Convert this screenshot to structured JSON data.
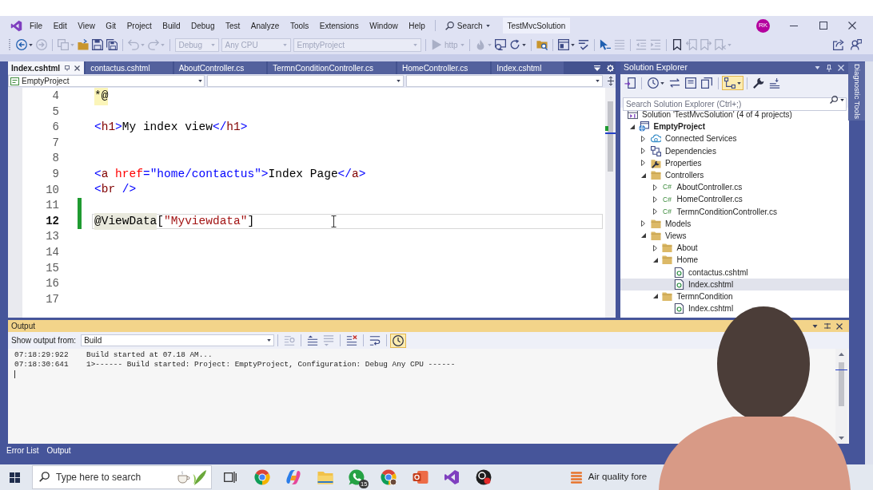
{
  "title_bar": {
    "menu": [
      "File",
      "Edit",
      "View",
      "Git",
      "Project",
      "Build",
      "Debug",
      "Test",
      "Analyze",
      "Tools",
      "Extensions",
      "Window",
      "Help"
    ],
    "search": "Search",
    "solution": "TestMvcSolution",
    "account_initials": "RK"
  },
  "toolbar": {
    "groups": [
      [
        {
          "kind": "back",
          "disabled": false,
          "menu": true
        },
        {
          "kind": "forward",
          "disabled": true
        }
      ],
      [
        {
          "kind": "new_item",
          "disabled": true,
          "menu": true
        },
        {
          "kind": "open",
          "disabled": false
        },
        {
          "kind": "save",
          "disabled": false
        },
        {
          "kind": "save_all",
          "disabled": false
        }
      ],
      [
        {
          "kind": "undo",
          "disabled": true,
          "menu": true
        },
        {
          "kind": "redo",
          "disabled": true,
          "menu": true
        }
      ],
      [
        {
          "kind": "combo",
          "value": "Debug",
          "disabled": true
        },
        {
          "kind": "combo",
          "value": "Any CPU",
          "disabled": true
        },
        {
          "kind": "combo",
          "value": "EmptyProject",
          "disabled": true
        }
      ],
      [
        {
          "kind": "start",
          "label": "http",
          "disabled": true,
          "menu": true
        }
      ],
      [
        {
          "kind": "hot_reload",
          "disabled": true,
          "menu": true
        },
        {
          "kind": "browser_link",
          "disabled": false
        },
        {
          "kind": "refresh",
          "disabled": false,
          "menu": true
        }
      ],
      [
        {
          "kind": "find_files",
          "disabled": false
        }
      ],
      [
        {
          "kind": "layout",
          "disabled": false,
          "menu": true
        },
        {
          "kind": "spellcheck",
          "disabled": false
        }
      ],
      [
        {
          "kind": "pointer",
          "disabled": false
        },
        {
          "kind": "comment",
          "disabled": true
        }
      ],
      [
        {
          "kind": "outdent",
          "disabled": true
        },
        {
          "kind": "indent",
          "disabled": true
        }
      ],
      [
        {
          "kind": "bookmark",
          "disabled": false
        },
        {
          "kind": "prev_bookmark",
          "disabled": true
        },
        {
          "kind": "next_bookmark",
          "disabled": true
        },
        {
          "kind": "clear_bookmarks",
          "disabled": true,
          "menu": true
        }
      ]
    ],
    "end": [
      {
        "kind": "share",
        "disabled": false
      },
      {
        "kind": "feedback",
        "disabled": false
      }
    ]
  },
  "editor_tabs": [
    {
      "label": "Index.cshtml",
      "selected": true
    },
    {
      "label": "contactus.cshtml",
      "selected": false
    },
    {
      "label": "AboutController.cs",
      "selected": false
    },
    {
      "label": "TermnConditionController.cs",
      "selected": false
    },
    {
      "label": "HomeController.cs",
      "selected": false
    },
    {
      "label": "Index.cshtml",
      "selected": false
    }
  ],
  "navigation_bar": {
    "project": "EmptyProject"
  },
  "code_lines": [
    {
      "number": "4",
      "current": false,
      "changed": false,
      "tokens": [
        {
          "kind": "razor_delimiter",
          "text": "*@"
        }
      ]
    },
    {
      "number": "5",
      "current": false,
      "changed": false
    },
    {
      "number": "6",
      "current": false,
      "changed": false,
      "tokens": [
        {
          "kind": "delimiter",
          "text": "<"
        },
        {
          "kind": "element",
          "text": "h1"
        },
        {
          "kind": "delimiter",
          "text": ">"
        },
        {
          "kind": "text",
          "text": "My index view"
        },
        {
          "kind": "delimiter",
          "text": "</"
        },
        {
          "kind": "element",
          "text": "h1"
        },
        {
          "kind": "delimiter",
          "text": ">"
        }
      ]
    },
    {
      "number": "7",
      "current": false,
      "changed": false
    },
    {
      "number": "8",
      "current": false,
      "changed": false
    },
    {
      "number": "9",
      "current": false,
      "changed": false,
      "tokens": [
        {
          "kind": "delimiter",
          "text": "<"
        },
        {
          "kind": "element",
          "text": "a"
        },
        {
          "kind": "attribute",
          "text": " href"
        },
        {
          "kind": "delimiter",
          "text": "="
        },
        {
          "kind": "value",
          "text": "\"home/contactus\""
        },
        {
          "kind": "delimiter",
          "text": ">"
        },
        {
          "kind": "text",
          "text": "Index Page"
        },
        {
          "kind": "delimiter",
          "text": "</"
        },
        {
          "kind": "element",
          "text": "a"
        },
        {
          "kind": "delimiter",
          "text": ">"
        }
      ]
    },
    {
      "number": "10",
      "current": false,
      "changed": false,
      "tokens": [
        {
          "kind": "delimiter",
          "text": "<"
        },
        {
          "kind": "element",
          "text": "br"
        },
        {
          "kind": "delimiter",
          "text": " />"
        }
      ]
    },
    {
      "number": "11",
      "current": false,
      "changed": true
    },
    {
      "number": "12",
      "current": true,
      "changed": true,
      "tokens": [
        {
          "kind": "razor",
          "text": "@ViewData"
        },
        {
          "kind": "text",
          "text": "["
        },
        {
          "kind": "string",
          "text": "\"Myviewdata\""
        },
        {
          "kind": "text",
          "text": "]"
        }
      ]
    },
    {
      "number": "13",
      "current": false,
      "changed": false
    },
    {
      "number": "14",
      "current": false,
      "changed": false
    },
    {
      "number": "15",
      "current": false,
      "changed": false
    },
    {
      "number": "16",
      "current": false,
      "changed": false
    },
    {
      "number": "17",
      "current": false,
      "changed": false
    }
  ],
  "solution_explorer": {
    "title": "Solution Explorer",
    "toolbar": [
      [
        {
          "kind": "sync",
          "on": false
        }
      ],
      [
        {
          "kind": "history",
          "on": false,
          "menu": true
        },
        {
          "kind": "swap",
          "on": false
        },
        {
          "kind": "collapse_all",
          "on": false
        },
        {
          "kind": "copy",
          "on": false
        }
      ],
      [
        {
          "kind": "tree_view",
          "on": true,
          "menu": true
        }
      ],
      [
        {
          "kind": "properties",
          "on": false
        },
        {
          "kind": "preview",
          "on": false
        }
      ]
    ],
    "search_placeholder": "Search Solution Explorer (Ctrl+;)",
    "tree": [
      {
        "label": "Solution 'TestMvcSolution' (4 of 4 projects)",
        "kind": "solution",
        "selected": false,
        "children": [
          {
            "label": "EmptyProject",
            "kind": "project",
            "expanded": true,
            "selected": false,
            "children": [
              {
                "label": "Connected Services",
                "kind": "connected_services",
                "expanded": false,
                "selected": false
              },
              {
                "label": "Dependencies",
                "kind": "dependencies",
                "expanded": false,
                "selected": false
              },
              {
                "label": "Properties",
                "kind": "properties",
                "expanded": false,
                "selected": false
              },
              {
                "label": "Controllers",
                "kind": "folder",
                "expanded": true,
                "selected": false,
                "children": [
                  {
                    "label": "AboutController.cs",
                    "kind": "csharp",
                    "badge": "C#",
                    "expanded": false,
                    "selected": false
                  },
                  {
                    "label": "HomeController.cs",
                    "kind": "csharp",
                    "badge": "C#",
                    "expanded": false,
                    "selected": false
                  },
                  {
                    "label": "TermnConditionController.cs",
                    "kind": "csharp",
                    "badge": "C#",
                    "expanded": false,
                    "selected": false
                  }
                ]
              },
              {
                "label": "Models",
                "kind": "folder",
                "expanded": false,
                "selected": false
              },
              {
                "label": "Views",
                "kind": "folder",
                "expanded": true,
                "selected": false,
                "children": [
                  {
                    "label": "About",
                    "kind": "folder",
                    "expanded": false,
                    "selected": false
                  },
                  {
                    "label": "Home",
                    "kind": "folder",
                    "expanded": true,
                    "selected": false,
                    "children": [
                      {
                        "label": "contactus.cshtml",
                        "kind": "razor",
                        "selected": false
                      },
                      {
                        "label": "Index.cshtml",
                        "kind": "razor",
                        "selected": true
                      }
                    ]
                  },
                  {
                    "label": "TermnCondition",
                    "kind": "folder",
                    "expanded": true,
                    "selected": false,
                    "children": [
                      {
                        "label": "Index.cshtml",
                        "kind": "razor",
                        "selected": false
                      }
                    ]
                  }
                ]
              }
            ]
          }
        ]
      }
    ]
  },
  "side_tab": "Diagnostic Tools",
  "output": {
    "title": "Output",
    "source_label": "Show output from:",
    "source": "Build",
    "toolbar": [
      [
        {
          "kind": "find_message",
          "disabled": true,
          "on": false
        }
      ],
      [
        {
          "kind": "prev_message",
          "disabled": false,
          "on": false
        },
        {
          "kind": "next_message",
          "disabled": true,
          "on": false
        }
      ],
      [
        {
          "kind": "clear",
          "disabled": false,
          "on": false
        }
      ],
      [
        {
          "kind": "word_wrap",
          "disabled": false,
          "on": false
        }
      ],
      [
        {
          "kind": "timestamps",
          "disabled": false,
          "on": true
        }
      ]
    ],
    "lines": [
      {
        "time": "07:18:29:922",
        "message": "Build started at 07.18 AM..."
      },
      {
        "time": "07:18:30:641",
        "message": "1>------ Build started: Project: EmptyProject, Configuration: Debug Any CPU ------"
      }
    ]
  },
  "bottom_tabs": [
    "Error List",
    "Output"
  ],
  "taskbar": {
    "search_placeholder": "Type here to search",
    "apps": [
      {
        "kind": "task_view"
      },
      {
        "kind": "chrome"
      },
      {
        "kind": "copilot"
      },
      {
        "kind": "file_explorer"
      },
      {
        "kind": "whatsapp",
        "badge": "15"
      },
      {
        "kind": "chrome_profile"
      },
      {
        "kind": "powerpoint"
      },
      {
        "kind": "visual_studio"
      },
      {
        "kind": "recorder"
      }
    ],
    "weather": "Air quality fore"
  }
}
